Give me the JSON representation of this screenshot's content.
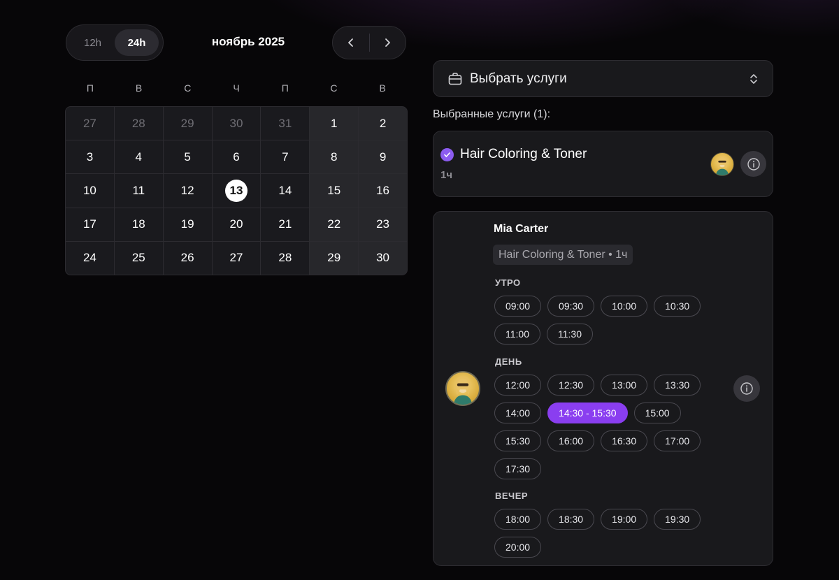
{
  "time_format": {
    "options": [
      {
        "label": "12h",
        "active": false
      },
      {
        "label": "24h",
        "active": true
      }
    ]
  },
  "calendar": {
    "month_title": "ноябрь 2025",
    "weekdays": [
      "П",
      "В",
      "С",
      "Ч",
      "П",
      "С",
      "В"
    ],
    "today": "13",
    "weeks": [
      [
        "27",
        "28",
        "29",
        "30",
        "31",
        "1",
        "2"
      ],
      [
        "3",
        "4",
        "5",
        "6",
        "7",
        "8",
        "9"
      ],
      [
        "10",
        "11",
        "12",
        "13",
        "14",
        "15",
        "16"
      ],
      [
        "17",
        "18",
        "19",
        "20",
        "21",
        "22",
        "23"
      ],
      [
        "24",
        "25",
        "26",
        "27",
        "28",
        "29",
        "30"
      ]
    ],
    "muted_first_week_count": 5
  },
  "service_select": {
    "label": "Выбрать услуги"
  },
  "selected": {
    "heading": "Выбранные услуги (1):",
    "service_name": "Hair Coloring & Toner",
    "duration": "1ч"
  },
  "master": {
    "name": "Mia Carter",
    "tag": "Hair Coloring & Toner • 1ч",
    "periods": [
      {
        "label": "УТРО",
        "slots": [
          "09:00",
          "09:30",
          "10:00",
          "10:30",
          "11:00",
          "11:30"
        ]
      },
      {
        "label": "ДЕНЬ",
        "slots": [
          "12:00",
          "12:30",
          "13:00",
          "13:30",
          "14:00",
          "14:30 - 15:30",
          "15:00",
          "15:30",
          "16:00",
          "16:30",
          "17:00",
          "17:30"
        ]
      },
      {
        "label": "ВЕЧЕР",
        "slots": [
          "18:00",
          "18:30",
          "19:00",
          "19:30",
          "20:00"
        ]
      }
    ],
    "selected_slot": "14:30 - 15:30"
  },
  "colors": {
    "accent": "#8a3ef0",
    "check": "#8c5cf0",
    "background": "#070608",
    "card": "#19191c"
  }
}
